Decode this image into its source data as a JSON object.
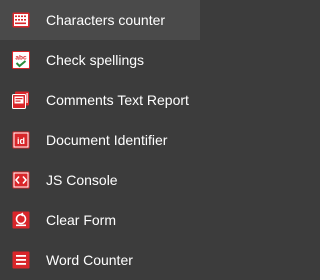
{
  "menu": {
    "items": [
      {
        "label": "Characters counter",
        "icon": "characters-counter-icon"
      },
      {
        "label": "Check spellings",
        "icon": "check-spellings-icon",
        "icon_text": "abc"
      },
      {
        "label": "Comments Text Report",
        "icon": "comments-report-icon"
      },
      {
        "label": "Document Identifier",
        "icon": "document-identifier-icon",
        "icon_text": "id"
      },
      {
        "label": "JS Console",
        "icon": "js-console-icon"
      },
      {
        "label": "Clear Form",
        "icon": "clear-form-icon"
      },
      {
        "label": "Word Counter",
        "icon": "word-counter-icon"
      }
    ]
  },
  "colors": {
    "background": "#3c3c3c",
    "text": "#ffffff",
    "icon_red": "#d9262a",
    "icon_green": "#2a8a3a"
  }
}
